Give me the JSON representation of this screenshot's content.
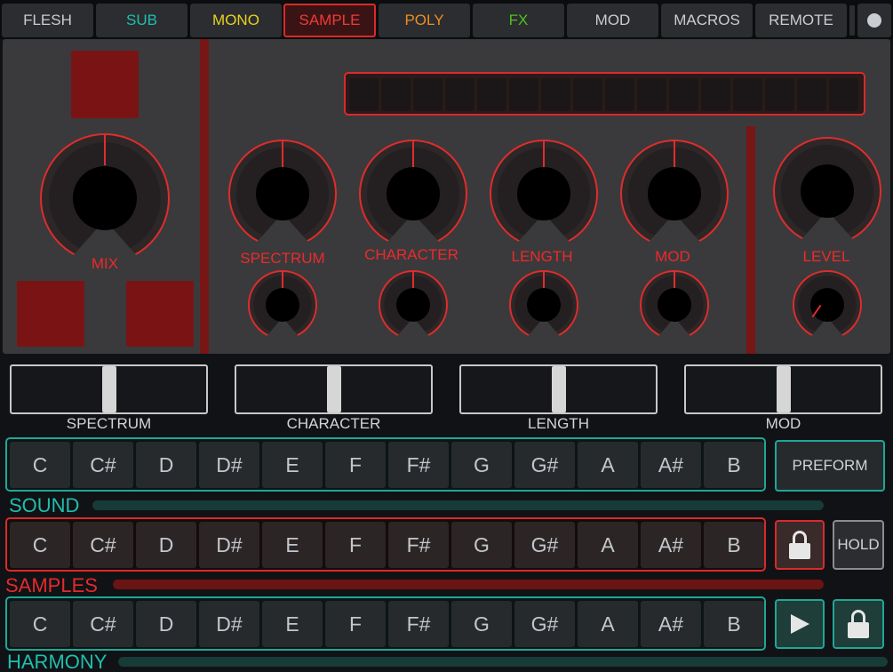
{
  "tabs": [
    {
      "label": "FLESH",
      "color": "#c9ccd0"
    },
    {
      "label": "SUB",
      "color": "#1fbfae"
    },
    {
      "label": "MONO",
      "color": "#e8d21e"
    },
    {
      "label": "SAMPLE",
      "color": "#ef3a3a"
    },
    {
      "label": "POLY",
      "color": "#ef8c1e"
    },
    {
      "label": "FX",
      "color": "#4fc21e"
    },
    {
      "label": "MOD",
      "color": "#c9ccd0"
    },
    {
      "label": "MACROS",
      "color": "#c9ccd0"
    },
    {
      "label": "REMOTE",
      "color": "#c9ccd0"
    }
  ],
  "active_tab": "SAMPLE",
  "knobs": {
    "mix": "MIX",
    "spectrum": "SPECTRUM",
    "character": "CHARACTER",
    "length": "LENGTH",
    "mod": "MOD",
    "level": "LEVEL"
  },
  "sequencer": {
    "steps": 16
  },
  "sliders": [
    {
      "label": "SPECTRUM",
      "value": 0.5
    },
    {
      "label": "CHARACTER",
      "value": 0.5
    },
    {
      "label": "LENGTH",
      "value": 0.5
    },
    {
      "label": "MOD",
      "value": 0.5
    }
  ],
  "notes": [
    "C",
    "C#",
    "D",
    "D#",
    "E",
    "F",
    "F#",
    "G",
    "G#",
    "A",
    "A#",
    "B"
  ],
  "rows": {
    "sound": {
      "label": "SOUND",
      "color": "#1fbfae"
    },
    "samples": {
      "label": "SAMPLES",
      "color": "#e32b2b"
    },
    "harmony": {
      "label": "HARMONY",
      "color": "#1fbfae"
    }
  },
  "buttons": {
    "preform": "PREFORM",
    "hold": "HOLD",
    "lock_icon": "lock-icon",
    "play_icon": "play-icon"
  },
  "colors": {
    "accent_red": "#e02c2c",
    "accent_teal": "#1ea797",
    "panel": "#3a3a3c"
  }
}
